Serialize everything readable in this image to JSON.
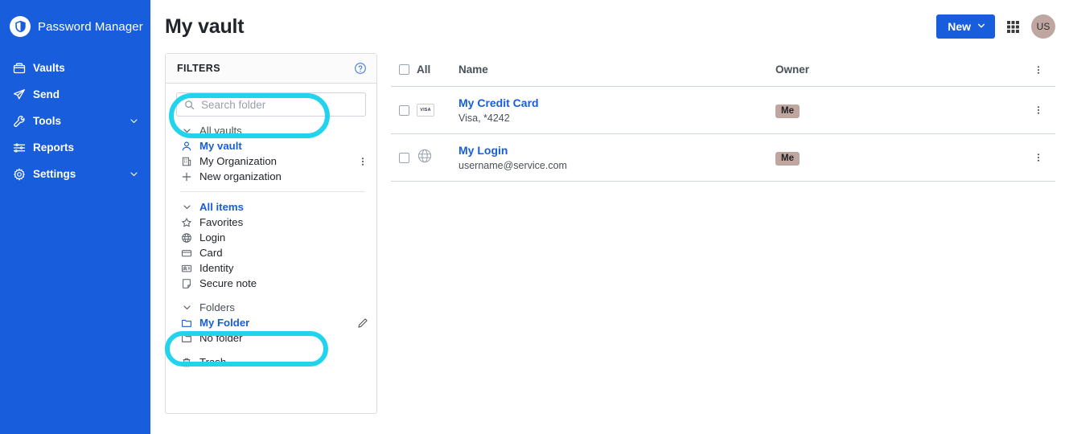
{
  "brand": {
    "name": "Password Manager",
    "logo_icon": "shield-icon"
  },
  "colors": {
    "sidebar_bg": "#175DDC",
    "accent": "#175DDC",
    "highlight": "#22D3EE",
    "badge_bg": "#bfa6a0",
    "avatar_bg": "#bfa6a0"
  },
  "sidebar": {
    "items": [
      {
        "label": "Vaults",
        "icon": "vault-icon",
        "chevron": false
      },
      {
        "label": "Send",
        "icon": "send-icon",
        "chevron": false
      },
      {
        "label": "Tools",
        "icon": "wrench-icon",
        "chevron": true
      },
      {
        "label": "Reports",
        "icon": "sliders-icon",
        "chevron": false
      },
      {
        "label": "Settings",
        "icon": "gear-icon",
        "chevron": true
      }
    ]
  },
  "header": {
    "title": "My vault",
    "new_button": "New",
    "apps_icon": "grid-icon",
    "avatar_initials": "US"
  },
  "filters": {
    "title": "FILTERS",
    "help_icon": "help-circle-icon",
    "search": {
      "value": "",
      "placeholder": "Search folder",
      "icon": "search-icon"
    },
    "vault_group": [
      {
        "label": "All vaults",
        "icon": "chevron-down-icon",
        "state": "group",
        "more": false
      },
      {
        "label": "My vault",
        "icon": "user-icon",
        "state": "active",
        "more": false
      },
      {
        "label": "My Organization",
        "icon": "organization-icon",
        "state": "normal",
        "more": true
      },
      {
        "label": "New organization",
        "icon": "plus-icon",
        "state": "normal",
        "more": false
      }
    ],
    "item_group": [
      {
        "label": "All items",
        "icon": "chevron-down-icon",
        "state": "group",
        "more": false
      },
      {
        "label": "Favorites",
        "icon": "star-icon",
        "state": "normal",
        "more": false
      },
      {
        "label": "Login",
        "icon": "globe-icon",
        "state": "normal",
        "more": false
      },
      {
        "label": "Card",
        "icon": "card-icon",
        "state": "normal",
        "more": false
      },
      {
        "label": "Identity",
        "icon": "identity-icon",
        "state": "normal",
        "more": false
      },
      {
        "label": "Secure note",
        "icon": "note-icon",
        "state": "normal",
        "more": false
      }
    ],
    "folder_group": [
      {
        "label": "Folders",
        "icon": "chevron-down-icon",
        "state": "group",
        "more": false
      },
      {
        "label": "My Folder",
        "icon": "folder-icon",
        "state": "active",
        "more": true
      },
      {
        "label": "No folder",
        "icon": "folder-icon",
        "state": "normal",
        "more": false
      }
    ],
    "trash": {
      "label": "Trash",
      "icon": "trash-icon"
    }
  },
  "table": {
    "columns": {
      "all": "All",
      "name": "Name",
      "owner": "Owner"
    },
    "header_menu_icon": "vertical-dots-icon",
    "rows": [
      {
        "name": "My Credit Card",
        "subtitle": "Visa, *4242",
        "owner": "Me",
        "icon": "visa-card-icon",
        "icon_text": "VISA",
        "menu_icon": "vertical-dots-icon"
      },
      {
        "name": "My Login",
        "subtitle": "username@service.com",
        "owner": "Me",
        "icon": "globe-icon",
        "icon_text": "",
        "menu_icon": "vertical-dots-icon"
      }
    ]
  },
  "highlights": [
    {
      "name": "search-folder-highlight",
      "target": "search-input"
    },
    {
      "name": "my-folder-highlight",
      "target": "tree-item-my-folder"
    }
  ]
}
